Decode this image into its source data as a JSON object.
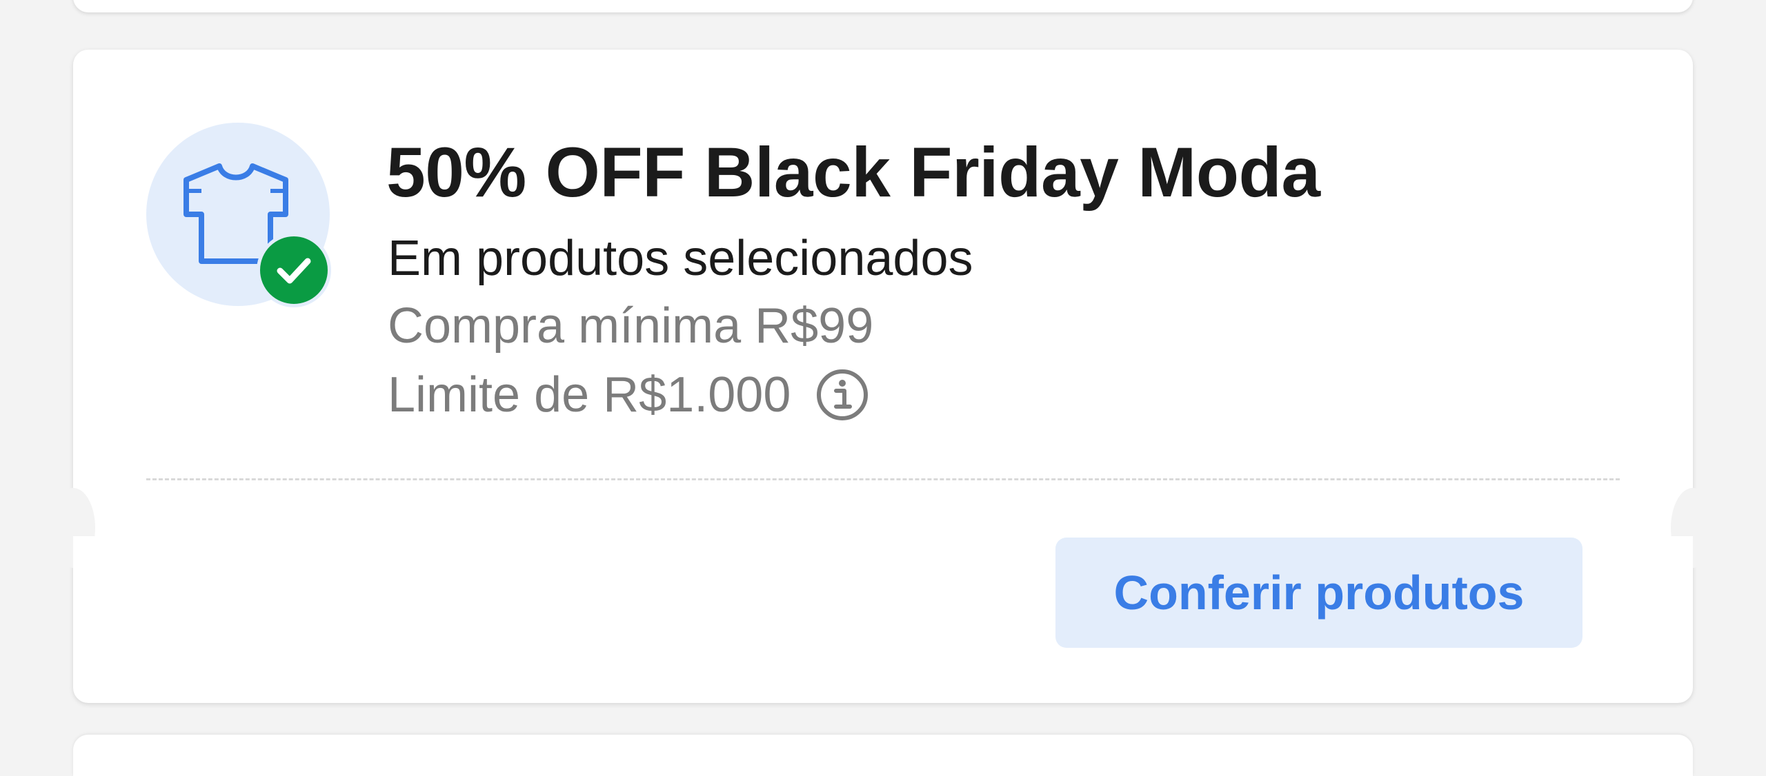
{
  "coupon": {
    "title": "50% OFF Black Friday Moda",
    "subtitle": "Em produtos selecionados",
    "min_purchase": "Compra mínima R$99",
    "limit": "Limite de R$1.000",
    "icon": "t-shirt-icon",
    "badge_icon": "check-icon",
    "info_icon": "info-icon",
    "cta_label": "Conferir produtos"
  },
  "colors": {
    "background": "#f3f3f3",
    "card": "#ffffff",
    "icon_bg": "#e3edfb",
    "icon_stroke": "#3a7de6",
    "badge": "#0a9b43",
    "title": "#1b1b1b",
    "muted": "#7c7c7c",
    "button_bg": "#e3edfb",
    "button_text": "#3a7de6"
  }
}
